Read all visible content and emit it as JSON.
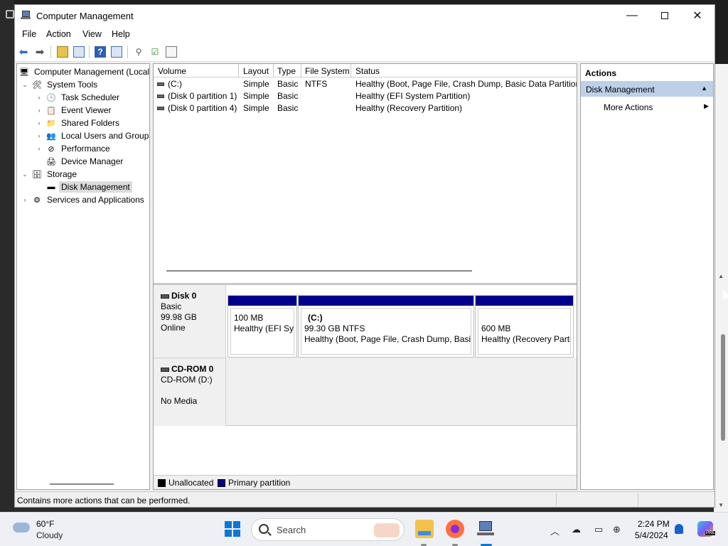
{
  "window": {
    "title": "Computer Management",
    "controls": {
      "minimize": "—",
      "maximize": "",
      "close": "✕"
    }
  },
  "menu": [
    "File",
    "Action",
    "View",
    "Help"
  ],
  "tree": {
    "root": "Computer Management (Local",
    "items": [
      {
        "label": "System Tools",
        "expanded": true
      },
      {
        "label": "Task Scheduler"
      },
      {
        "label": "Event Viewer"
      },
      {
        "label": "Shared Folders"
      },
      {
        "label": "Local Users and Groups"
      },
      {
        "label": "Performance"
      },
      {
        "label": "Device Manager"
      },
      {
        "label": "Storage",
        "expanded": true
      },
      {
        "label": "Disk Management",
        "selected": true
      },
      {
        "label": "Services and Applications"
      }
    ]
  },
  "volume_list": {
    "columns": [
      "Volume",
      "Layout",
      "Type",
      "File System",
      "Status"
    ],
    "rows": [
      [
        "(C:)",
        "Simple",
        "Basic",
        "NTFS",
        "Healthy (Boot, Page File, Crash Dump, Basic Data Partition)"
      ],
      [
        "(Disk 0 partition 1)",
        "Simple",
        "Basic",
        "",
        "Healthy (EFI System Partition)"
      ],
      [
        "(Disk 0 partition 4)",
        "Simple",
        "Basic",
        "",
        "Healthy (Recovery Partition)"
      ]
    ]
  },
  "disks": [
    {
      "name": "Disk 0",
      "type": "Basic",
      "size": "99.98 GB",
      "state": "Online",
      "partitions": [
        {
          "title": "",
          "size": "100 MB",
          "status": "Healthy (EFI Sys"
        },
        {
          "title": "(C:)",
          "size": "99.30 GB NTFS",
          "status": "Healthy (Boot, Page File, Crash Dump, Basic"
        },
        {
          "title": "",
          "size": "600 MB",
          "status": "Healthy (Recovery Parti"
        }
      ]
    },
    {
      "name": "CD-ROM 0",
      "type": "CD-ROM (D:)",
      "state": "No Media"
    }
  ],
  "legend": [
    {
      "label": "Unallocated",
      "color": "#000000"
    },
    {
      "label": "Primary partition",
      "color": "#00008b"
    }
  ],
  "actions": {
    "title": "Actions",
    "section": "Disk Management",
    "items": [
      "More Actions"
    ]
  },
  "status_bar": "Contains more actions that can be performed.",
  "taskbar": {
    "weather": {
      "temp": "60°F",
      "condition": "Cloudy"
    },
    "search_placeholder": "Search",
    "clock": {
      "time": "2:24 PM",
      "date": "5/4/2024"
    },
    "copilot_badge": "PRE"
  },
  "colors": {
    "primary_partition": "#00008b",
    "selection": "#bcd0e8",
    "accent": "#0a78d4"
  }
}
